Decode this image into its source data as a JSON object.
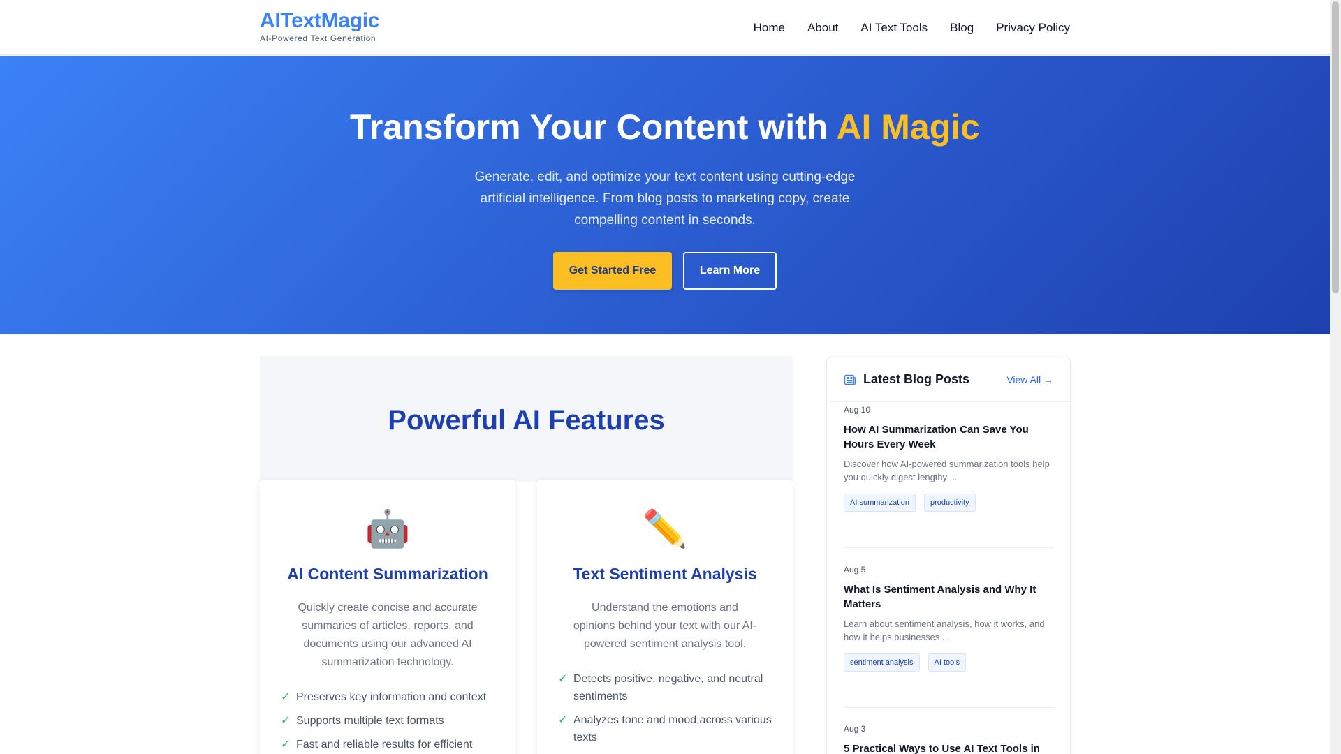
{
  "brand": {
    "name": "AITextMagic",
    "tagline": "AI-Powered Text Generation"
  },
  "nav": {
    "items": [
      "Home",
      "About",
      "AI Text Tools",
      "Blog",
      "Privacy Policy"
    ]
  },
  "hero": {
    "title_main": "Transform Your Content with",
    "title_accent": "AI Magic",
    "subtitle": "Generate, edit, and optimize your text content using cutting-edge artificial intelligence. From blog posts to marketing copy, create compelling content in seconds.",
    "primary_button": "Get Started Free",
    "secondary_button": "Learn More"
  },
  "features": {
    "title": "Powerful AI Features",
    "cards": [
      {
        "icon": "robot-icon",
        "icon_glyph": "🤖",
        "title": "AI Content Summarization",
        "description": "Quickly create concise and accurate summaries of articles, reports, and documents using our advanced AI summarization technology.",
        "points": [
          "Preserves key information and context",
          "Supports multiple text formats",
          "Fast and reliable results for efficient"
        ]
      },
      {
        "icon": "pencil-icon",
        "icon_glyph": "✏️",
        "title": "Text Sentiment Analysis",
        "description": "Understand the emotions and opinions behind your text with our AI-powered sentiment analysis tool.",
        "points": [
          "Detects positive, negative, and neutral sentiments",
          "Analyzes tone and mood across various texts"
        ]
      }
    ]
  },
  "sidebar": {
    "title": "Latest Blog Posts",
    "view_all": "View All →",
    "posts": [
      {
        "date": "Aug 10",
        "title": "How AI Summarization Can Save You Hours Every Week",
        "excerpt": "Discover how AI-powered summarization tools help you quickly digest lengthy ...",
        "tags": [
          "AI summarization",
          "productivity"
        ]
      },
      {
        "date": "Aug 5",
        "title": "What Is Sentiment Analysis and Why It Matters",
        "excerpt": "Learn about sentiment analysis, how it works, and how it helps businesses ...",
        "tags": [
          "sentiment analysis",
          "AI tools"
        ]
      },
      {
        "date": "Aug 3",
        "title": "5 Practical Ways to Use AI Text Tools in"
      }
    ]
  },
  "colors": {
    "brand_blue": "#3b82f6",
    "accent_yellow": "#fbbf24",
    "heading_blue": "#1e40af",
    "check_green": "#22c55e"
  }
}
